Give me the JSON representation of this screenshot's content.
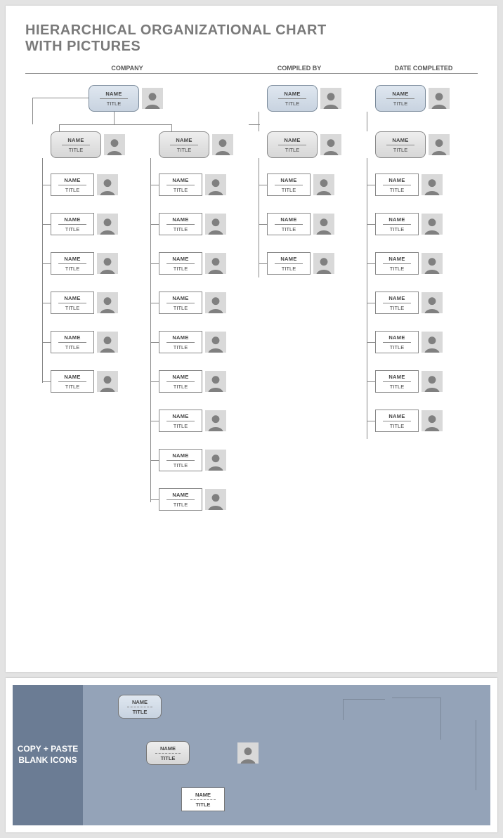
{
  "title_line1": "HIERARCHICAL ORGANIZATIONAL CHART",
  "title_line2": "WITH PICTURES",
  "headers": {
    "company": "COMPANY",
    "compiled_by": "COMPILED BY",
    "date_completed": "DATE COMPLETED"
  },
  "labels": {
    "name": "NAME",
    "title": "TITLE"
  },
  "copy_paste": "COPY + PASTE BLANK ICONS",
  "chart_data": {
    "type": "diagram",
    "description": "Hierarchical org chart template with photo placeholders. One top-level head. Beneath it, four department heads (two shown under the root, two more columns to the right). Department 1 has 6 direct reports. Department 2 has 9 direct reports. Department 3 (right column 1) has a sub-head with 3 reports. Department 4 (right column 2) has a sub-head with 7 reports. All boxes contain placeholder NAME and TITLE fields with a portrait silhouette icon.",
    "root": {
      "name": "NAME",
      "title": "TITLE"
    },
    "departments": [
      {
        "name": "NAME",
        "title": "TITLE",
        "reports": 6
      },
      {
        "name": "NAME",
        "title": "TITLE",
        "reports": 9
      },
      {
        "head": {
          "name": "NAME",
          "title": "TITLE"
        },
        "sub": {
          "name": "NAME",
          "title": "TITLE"
        },
        "reports": 3
      },
      {
        "head": {
          "name": "NAME",
          "title": "TITLE"
        },
        "sub": {
          "name": "NAME",
          "title": "TITLE"
        },
        "reports": 7
      }
    ]
  }
}
